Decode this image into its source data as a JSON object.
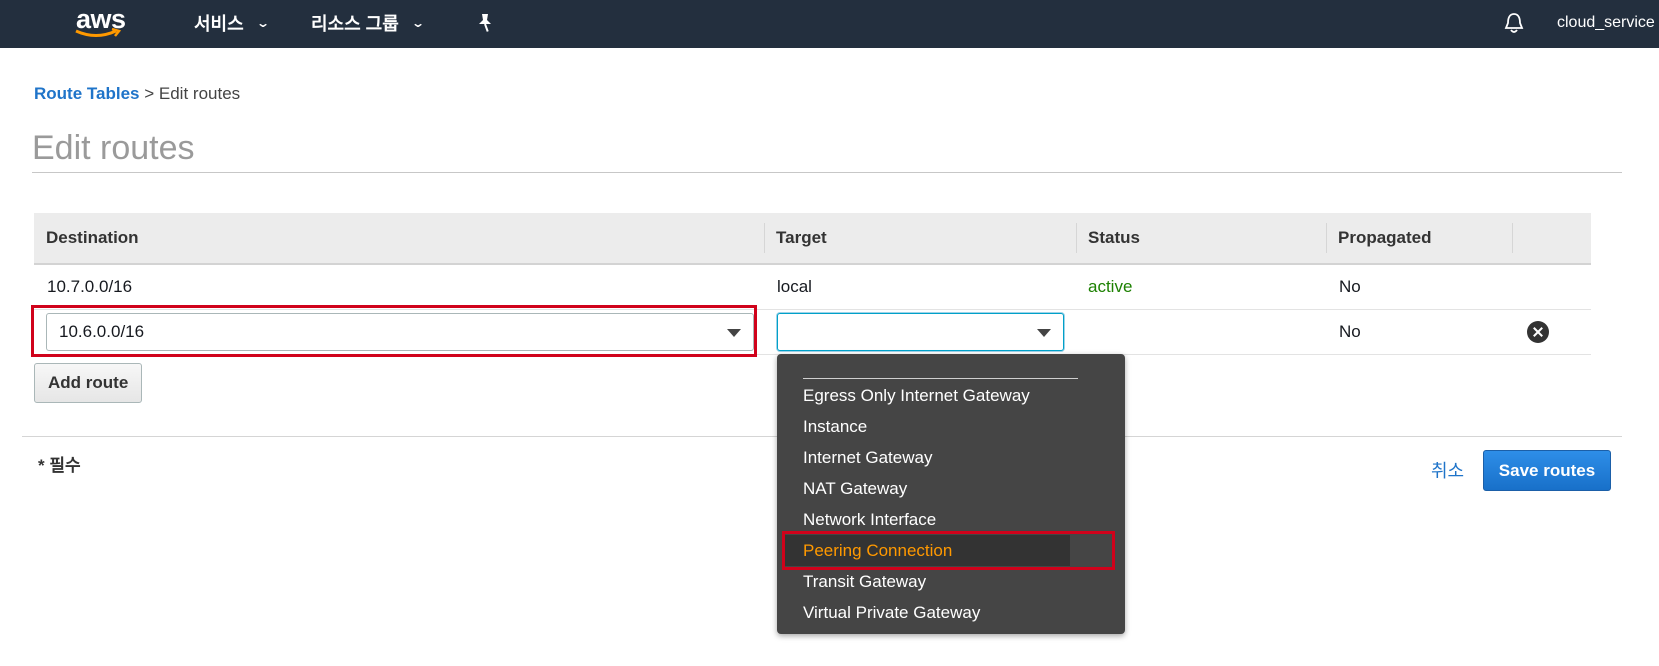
{
  "nav": {
    "logo_text": "aws",
    "services_label": "서비스",
    "resource_groups_label": "리소스 그룹",
    "pin_icon": "pin-icon",
    "bell_icon": "bell-icon",
    "account_label": "cloud_service"
  },
  "breadcrumb": {
    "parent": "Route Tables",
    "separator": ">",
    "current": "Edit routes"
  },
  "page": {
    "title": "Edit routes"
  },
  "table": {
    "columns": [
      "Destination",
      "Target",
      "Status",
      "Propagated"
    ],
    "rows": [
      {
        "destination": "10.7.0.0/16",
        "target": "local",
        "status": "active",
        "propagated": "No"
      },
      {
        "destination": "10.6.0.0/16",
        "target": "",
        "status": "",
        "propagated": "No"
      }
    ]
  },
  "buttons": {
    "add_route": "Add route",
    "cancel": "취소",
    "save_routes": "Save routes"
  },
  "footer": {
    "required_note": "* 필수"
  },
  "target_dropdown": {
    "options": [
      "Egress Only Internet Gateway",
      "Instance",
      "Internet Gateway",
      "NAT Gateway",
      "Network Interface",
      "Peering Connection",
      "Transit Gateway",
      "Virtual Private Gateway"
    ],
    "highlighted": "Peering Connection"
  },
  "colors": {
    "nav_bg": "#232f3e",
    "link_blue": "#1f74c9",
    "active_green": "#1d8102",
    "highlight_orange": "#ff9900",
    "annotation_red": "#d0021b",
    "primary_button": "#1870c9"
  }
}
